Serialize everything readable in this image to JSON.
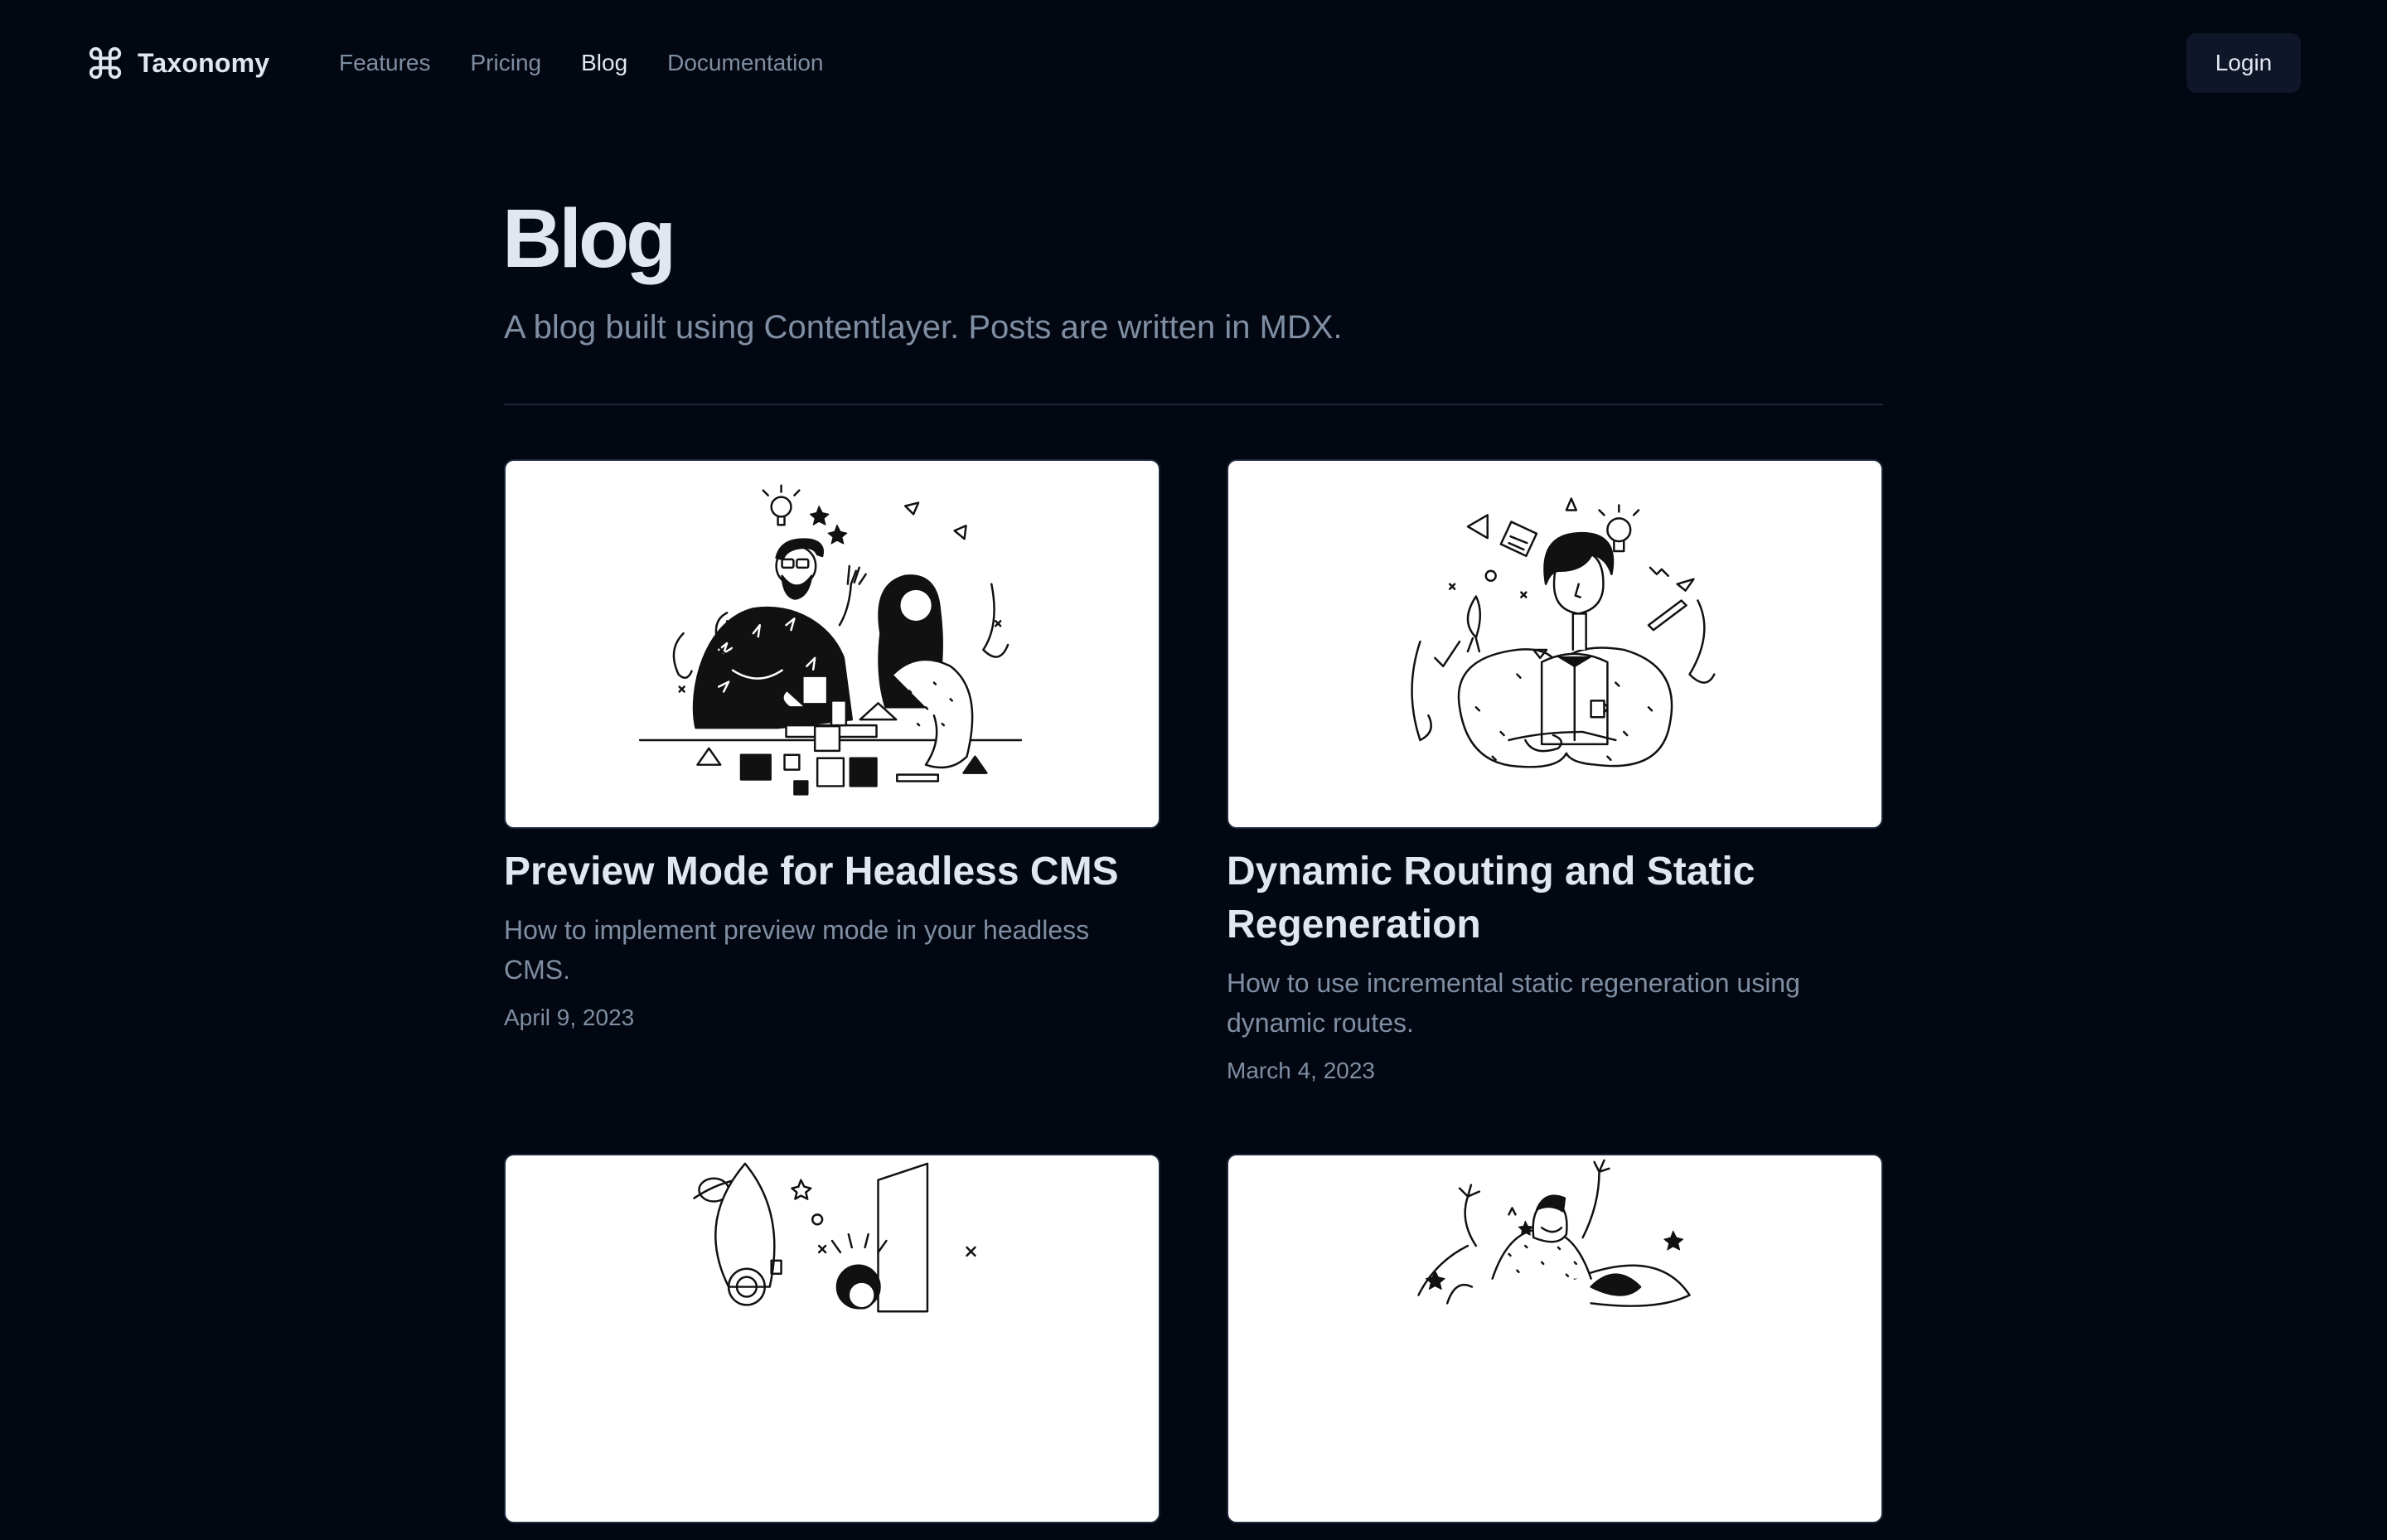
{
  "header": {
    "brand": {
      "name": "Taxonomy",
      "icon": "command-icon"
    },
    "nav": [
      {
        "label": "Features",
        "active": false
      },
      {
        "label": "Pricing",
        "active": false
      },
      {
        "label": "Blog",
        "active": true
      },
      {
        "label": "Documentation",
        "active": false
      }
    ],
    "login_label": "Login"
  },
  "page": {
    "title": "Blog",
    "subtitle": "A blog built using Contentlayer. Posts are written in MDX."
  },
  "posts": [
    {
      "title": "Preview Mode for Headless CMS",
      "excerpt": "How to implement preview mode in your headless CMS.",
      "date": "April 9, 2023"
    },
    {
      "title": "Dynamic Routing and Static Regeneration",
      "excerpt": "How to use incremental static regeneration using dynamic routes.",
      "date": "March 4, 2023"
    },
    {
      "title": "",
      "excerpt": "",
      "date": ""
    },
    {
      "title": "",
      "excerpt": "",
      "date": ""
    }
  ],
  "colors": {
    "background": "#030711",
    "foreground": "#e1e7ef",
    "muted": "#7f8ea3",
    "border": "#1d283a",
    "button_bg": "#0f1629"
  }
}
